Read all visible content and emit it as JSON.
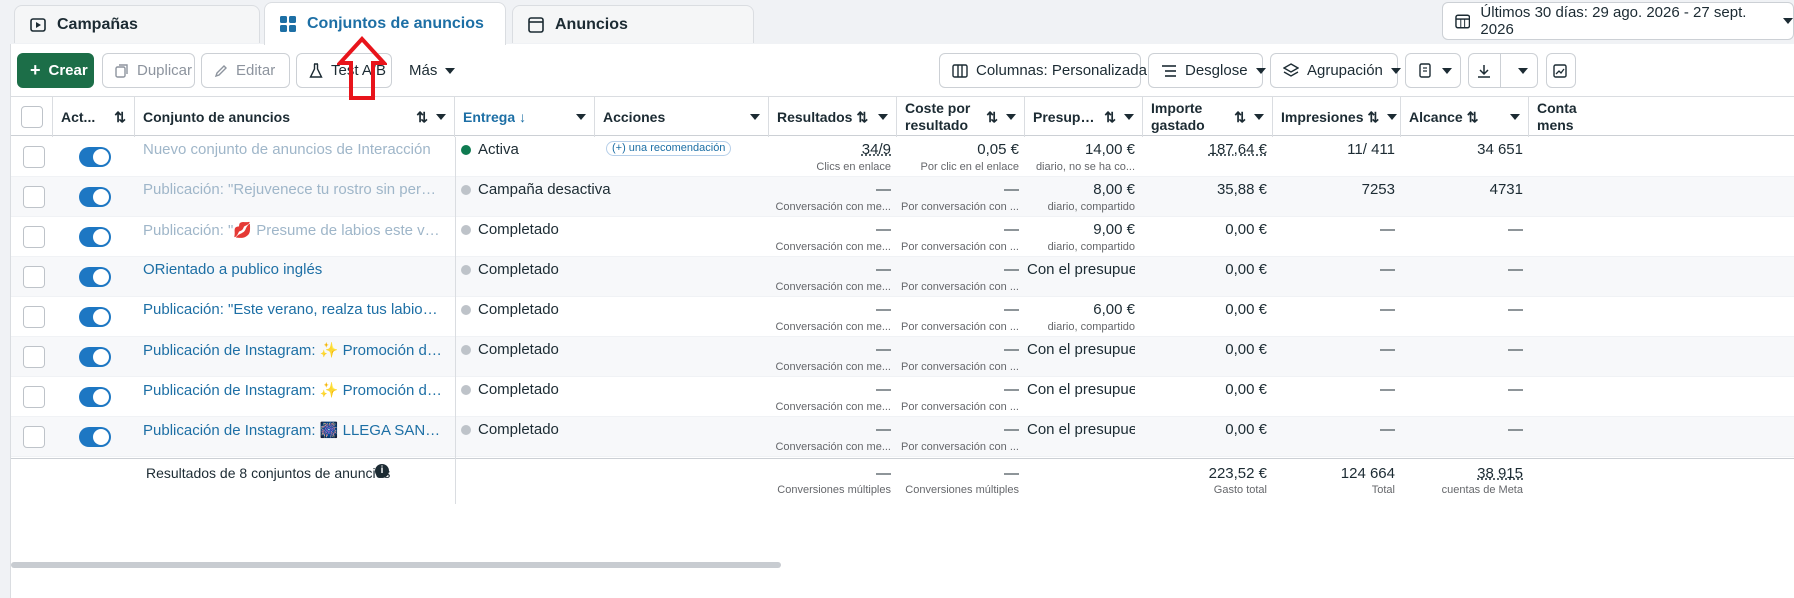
{
  "tabs": [
    {
      "label": "Campañas",
      "icon": "campaign-icon"
    },
    {
      "label": "Conjuntos de anuncios",
      "icon": "grid-icon"
    },
    {
      "label": "Anuncios",
      "icon": "ad-icon"
    }
  ],
  "date_range": {
    "label": "Últimos 30 días: 29 ago. 2026 - 27 sept. 2026",
    "icon": "calendar-icon"
  },
  "toolbar": {
    "create": "Crear",
    "duplicate": "Duplicar",
    "edit": "Editar",
    "ab_test": "Test A/B",
    "more": "Más",
    "columns": "Columnas: Personalizada",
    "breakdown": "Desglose",
    "grouping": "Agrupación"
  },
  "columns": {
    "active": "Act...",
    "name": "Conjunto de anuncios",
    "delivery": "Entrega",
    "actions": "Acciones",
    "results": "Resultados",
    "cost_per_result": "Coste por resultado",
    "budget": "Presupue...",
    "amount_spent": "Importe gastado",
    "impressions": "Impresiones",
    "reach": "Alcance",
    "contacts": "Conta mens"
  },
  "rows": [
    {
      "name": "Nuevo conjunto de anuncios de Interacción",
      "delivery": "Activa",
      "action": "(+) una recomendación",
      "results": "34/9",
      "results_sub": "Clics en enlace",
      "cost": "0,05 €",
      "cost_sub": "Por clic en el enlace",
      "budget": "14,00 €",
      "budget_sub": "diario, no se ha co...",
      "spent": "187,64 €",
      "impressions": "11/ 411",
      "reach": "34 651"
    },
    {
      "name": "Publicación: \"Rejuvenece tu rostro sin perder tu esen...",
      "delivery": "Campaña desactiva",
      "action": "",
      "results": "—",
      "results_sub": "Conversación con me...",
      "cost": "—",
      "cost_sub": "Por conversación con ...",
      "budget": "8,00 €",
      "budget_sub": "diario, compartido",
      "spent": "35,88 €",
      "impressions": "7253",
      "reach": "4731"
    },
    {
      "name": "Publicación: \"💋 Presume de labios este verano.\"",
      "delivery": "Completado",
      "action": "",
      "results": "—",
      "results_sub": "Conversación con me...",
      "cost": "—",
      "cost_sub": "Por conversación con ...",
      "budget": "9,00 €",
      "budget_sub": "diario, compartido",
      "spent": "0,00 €",
      "impressions": "—",
      "reach": "—"
    },
    {
      "name": "ORientado a publico inglés",
      "delivery": "Completado",
      "action": "",
      "results": "—",
      "results_sub": "Conversación con me...",
      "cost": "—",
      "cost_sub": "Por conversación con ...",
      "budget": "Con el presupue...",
      "budget_sub": "",
      "spent": "0,00 €",
      "impressions": "—",
      "reach": "—"
    },
    {
      "name": "Publicación: \"Este verano, realza tus labios con un re...",
      "delivery": "Completado",
      "action": "",
      "results": "—",
      "results_sub": "Conversación con me...",
      "cost": "—",
      "cost_sub": "Por conversación con ...",
      "budget": "6,00 €",
      "budget_sub": "diario, compartido",
      "spent": "0,00 €",
      "impressions": "—",
      "reach": "—"
    },
    {
      "name": "Publicación de Instagram: ✨ Promoción de verano...",
      "delivery": "Completado",
      "action": "",
      "results": "—",
      "results_sub": "Conversación con me...",
      "cost": "—",
      "cost_sub": "Por conversación con ...",
      "budget": "Con el presupue...",
      "budget_sub": "",
      "spent": "0,00 €",
      "impressions": "—",
      "reach": "—"
    },
    {
      "name": "Publicación de Instagram: ✨ Promoción de verano...",
      "delivery": "Completado",
      "action": "",
      "results": "—",
      "results_sub": "Conversación con me...",
      "cost": "—",
      "cost_sub": "Por conversación con ...",
      "budget": "Con el presupue...",
      "budget_sub": "",
      "spent": "0,00 €",
      "impressions": "—",
      "reach": "—"
    },
    {
      "name": "Publicación de Instagram: 🎆 LLEGA SAN JUAN 🎆",
      "delivery": "Completado",
      "action": "",
      "results": "—",
      "results_sub": "Conversación con me...",
      "cost": "—",
      "cost_sub": "Por conversación con ...",
      "budget": "Con el presupue...",
      "budget_sub": "",
      "spent": "0,00 €",
      "impressions": "—",
      "reach": "—"
    }
  ],
  "summary": {
    "label": "Resultados de 8 conjuntos de anuncios",
    "results": "—",
    "results_sub": "Conversiones múltiples",
    "cost": "—",
    "cost_sub": "Conversiones múltiples",
    "spent": "223,52 €",
    "spent_sub": "Gasto total",
    "impressions": "124 664",
    "impressions_sub": "Total",
    "reach": "38 915",
    "reach_sub": "cuentas de Meta"
  },
  "colors": {
    "primary_green": "#1c6e48",
    "link_blue": "#1d6fa5",
    "toggle_blue": "#1d77c3",
    "annotation_red": "#e8141b"
  }
}
